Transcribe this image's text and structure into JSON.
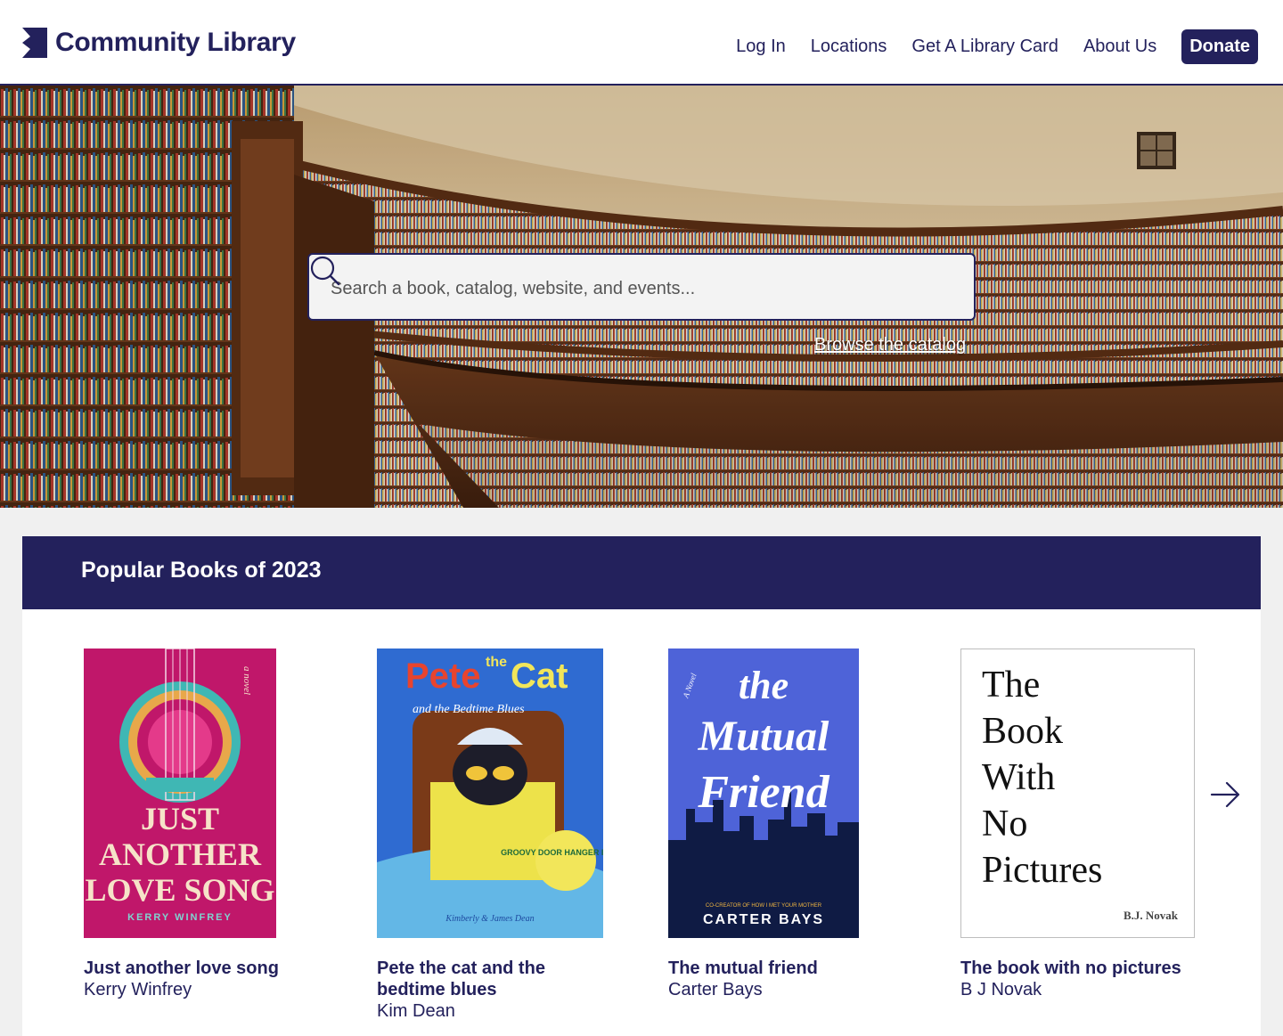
{
  "header": {
    "logo_text": "Community Library",
    "nav": {
      "login": "Log In",
      "locations": "Locations",
      "card": "Get A Library Card",
      "about": "About Us",
      "donate": "Donate"
    }
  },
  "hero": {
    "search_placeholder": "Search a book, catalog, website, and events...",
    "browse_link": "Browse the catalog"
  },
  "popular": {
    "title": "Popular Books of 2023",
    "books": [
      {
        "title": "Just another love song",
        "author": "Kerry Winfrey",
        "cover_lines": [
          "JUST",
          "ANOTHER",
          "LOVE SONG"
        ],
        "cover_author": "KERRY WINFREY",
        "cover_tag": "a novel"
      },
      {
        "title": "Pete the cat and the bedtime blues",
        "author": "Kim Dean",
        "cover_title_a": "Pete",
        "cover_title_the": "the",
        "cover_title_b": "Cat",
        "cover_subtitle": "and the Bedtime Blues",
        "cover_badge": "GROOVY DOOR HANGER INSIDE!",
        "cover_author": "Kimberly & James Dean"
      },
      {
        "title": "The mutual friend",
        "author": "Carter Bays",
        "cover_lines": [
          "the",
          "Mutual",
          "Friend"
        ],
        "cover_tag": "A Novel",
        "cover_credit": "CO-CREATOR OF HOW I MET YOUR MOTHER",
        "cover_author": "CARTER BAYS"
      },
      {
        "title": "The book with no pictures",
        "author": "B J Novak",
        "cover_lines": [
          "The",
          "Book",
          "With",
          "No",
          "Pictures"
        ],
        "cover_author": "B.J. Novak"
      }
    ]
  },
  "colors": {
    "brand": "#23215c",
    "background": "#f0f0f0"
  },
  "icons": [
    "logo-mark-icon",
    "search-icon",
    "arrow-right-icon"
  ]
}
